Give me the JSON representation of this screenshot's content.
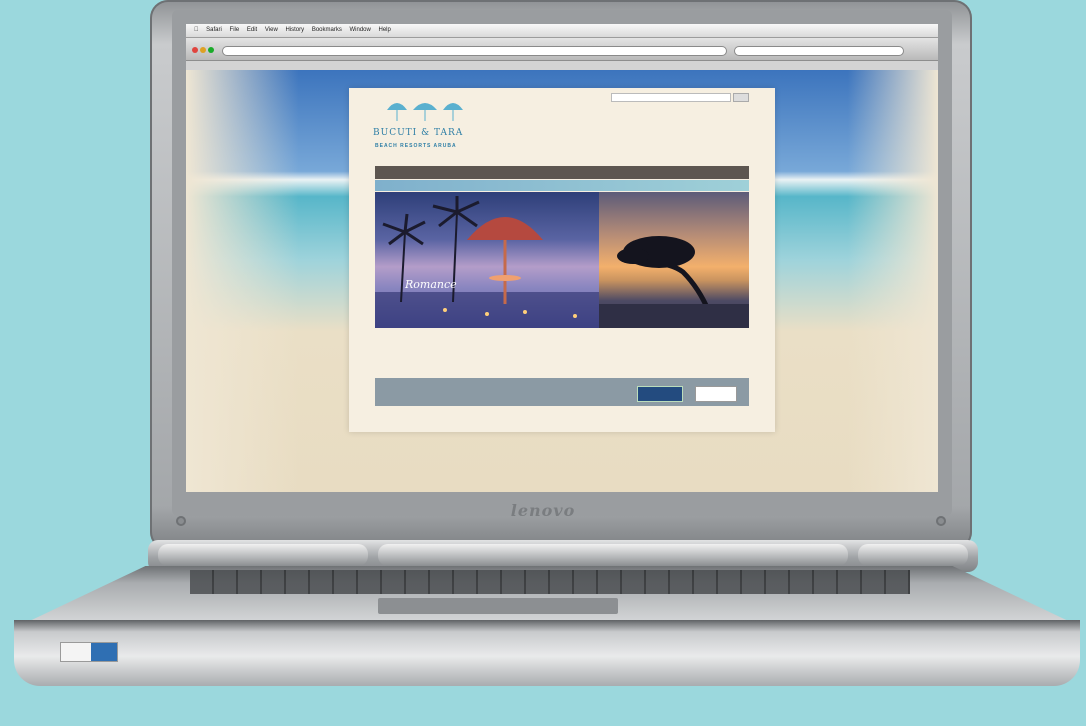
{
  "laptop": {
    "brand": "lenovo"
  },
  "browser": {
    "menu": [
      "Safari",
      "File",
      "Edit",
      "View",
      "History",
      "Bookmarks",
      "Window",
      "Help"
    ],
    "window_title": "",
    "url": "",
    "search_placeholder": "",
    "bookmarks": []
  },
  "site": {
    "top_links": [],
    "logo_name": "BUCUTI & TARA",
    "logo_sub": "BEACH RESORTS ARUBA",
    "search_label": "",
    "tagline": "",
    "main_nav": [],
    "sub_nav": [],
    "hero_script": "Romance",
    "intro_text": "",
    "promo_title": "",
    "promo_text": "",
    "footer_links": []
  },
  "colors": {
    "background": "#9bd8dd",
    "site_nav": "#5d5650",
    "logo": "#2f7fa6"
  }
}
